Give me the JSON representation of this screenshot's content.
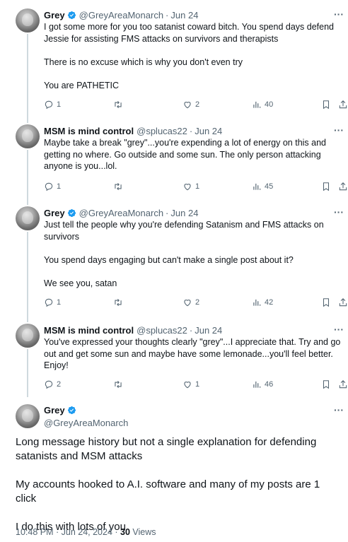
{
  "tweets": [
    {
      "name": "Grey",
      "verified": true,
      "handle": "@GreyAreaMonarch",
      "date": "Jun 24",
      "paragraphs": [
        "I got some more for you too satanist coward bitch. You spend days defend Jessie for assisting FMS attacks on survivors and therapists",
        "There is no excuse which is why you don't even try",
        "You are PATHETIC"
      ],
      "replies": "1",
      "retweets": "",
      "likes": "2",
      "views": "40"
    },
    {
      "name": "MSM is mind control",
      "verified": false,
      "handle": "@splucas22",
      "date": "Jun 24",
      "paragraphs": [
        "Maybe take a break \"grey\"...you're expending a lot of energy on this and getting no where. Go outside and some sun. The only person attacking anyone is you...lol."
      ],
      "replies": "1",
      "retweets": "",
      "likes": "1",
      "views": "45"
    },
    {
      "name": "Grey",
      "verified": true,
      "handle": "@GreyAreaMonarch",
      "date": "Jun 24",
      "paragraphs": [
        "Just tell the people why you're defending Satanism and FMS attacks on survivors",
        "You spend days engaging but can't make a single post about it?",
        "We see you, satan"
      ],
      "replies": "1",
      "retweets": "",
      "likes": "2",
      "views": "42"
    },
    {
      "name": "MSM is mind control",
      "verified": false,
      "handle": "@splucas22",
      "date": "Jun 24",
      "paragraphs": [
        "You've expressed your thoughts clearly \"grey\"...I appreciate that. Try and go out and get some sun and maybe have some lemonade...you'll feel better. Enjoy!"
      ],
      "replies": "2",
      "retweets": "",
      "likes": "1",
      "views": "46"
    }
  ],
  "main_tweet": {
    "name": "Grey",
    "verified": true,
    "handle": "@GreyAreaMonarch",
    "paragraphs": [
      "Long message history but not a single explanation for defending satanists and MSM attacks",
      "My accounts hooked to A.I. software and many of my posts are 1 click",
      "I do this with lots of you"
    ],
    "timestamp": "10:48 PM · Jun 24, 2024 · ",
    "views_count": "30",
    "views_label": " Views"
  },
  "more_glyph": "···",
  "dot_separator": "·",
  "colors": {
    "verified_badge": "#1d9bf0",
    "secondary_text": "#536471",
    "thread_line": "#cfd9de"
  },
  "icons": [
    "reply-icon",
    "retweet-icon",
    "like-icon",
    "views-icon",
    "bookmark-icon",
    "share-icon",
    "verified-badge-icon",
    "more-icon"
  ]
}
